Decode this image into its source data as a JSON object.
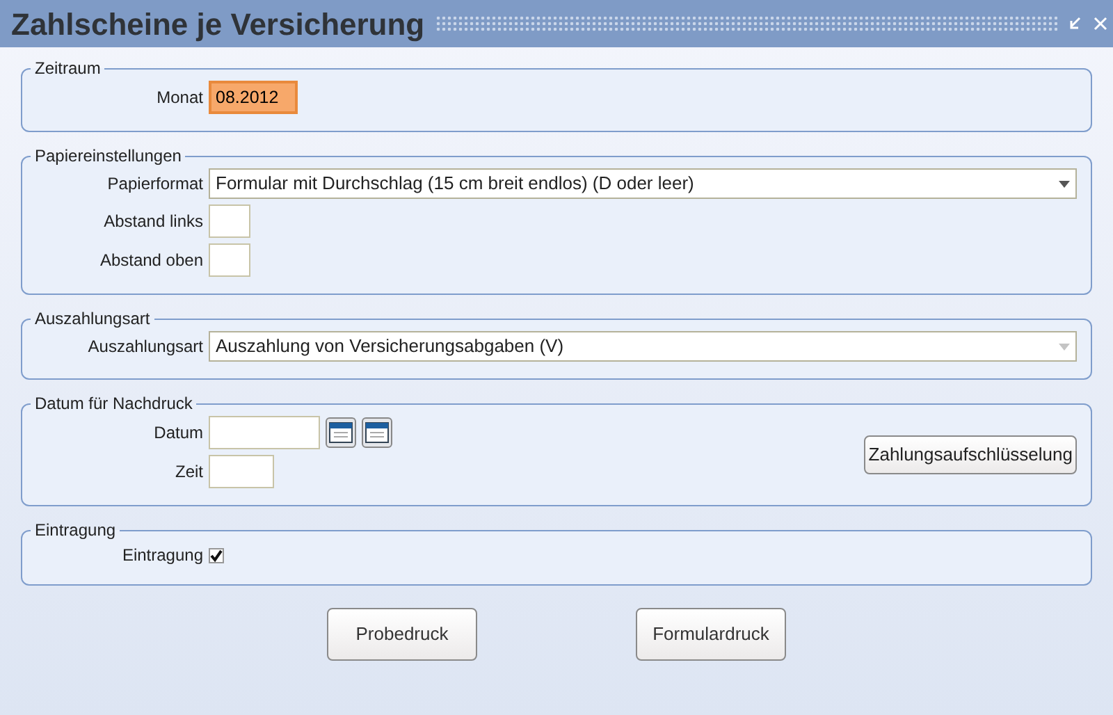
{
  "window": {
    "title": "Zahlscheine je Versicherung"
  },
  "sections": [
    {
      "legend": "Zeitraum",
      "fields": [
        {
          "kind": "month",
          "label": "Monat",
          "value": "08.2012",
          "focused": true
        }
      ]
    },
    {
      "legend": "Papiereinstellungen",
      "fields": [
        {
          "kind": "select",
          "label": "Papierformat",
          "value": "Formular mit Durchschlag (15 cm breit endlos) (D oder leer)",
          "disabled": false
        },
        {
          "kind": "number",
          "label": "Abstand links",
          "focused": false
        },
        {
          "kind": "number",
          "label": "Abstand oben",
          "focused": false
        }
      ]
    },
    {
      "legend": "Auszahlungsart",
      "fields": [
        {
          "kind": "select",
          "label": "Auszahlungsart",
          "value": "Auszahlung von Versicherungsabgaben (V)",
          "disabled": true
        }
      ]
    },
    {
      "legend": "Datum für Nachdruck",
      "side_button": "Zahlungsaufschlüsselung",
      "fields": [
        {
          "kind": "date",
          "label": "Datum"
        },
        {
          "kind": "time",
          "label": "Zeit",
          "focused": false
        }
      ]
    },
    {
      "legend": "Eintragung",
      "fields": [
        {
          "kind": "checkbox",
          "label": "Eintragung",
          "checked": true
        }
      ]
    }
  ],
  "buttons": [
    "Probedruck",
    "Formulardruck"
  ]
}
